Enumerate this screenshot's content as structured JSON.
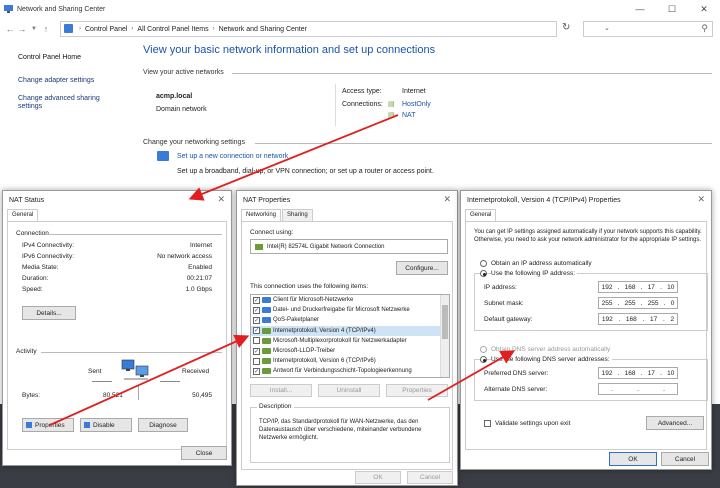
{
  "main": {
    "title": "Network and Sharing Center",
    "breadcrumb": [
      "Control Panel",
      "All Control Panel Items",
      "Network and Sharing Center"
    ],
    "left_pane": [
      "Control Panel Home",
      "Change adapter settings",
      "Change advanced sharing settings"
    ],
    "heading": "View your basic network information and set up connections",
    "active_networks_label": "View your active networks",
    "network_name": "acmp.local",
    "network_type": "Domain network",
    "access_type_label": "Access type:",
    "access_type_value": "Internet",
    "connections_label": "Connections:",
    "connection_1": "HostOnly",
    "connection_2": "NAT",
    "change_settings_label": "Change your networking settings",
    "setup_link": "Set up a new connection or network",
    "setup_desc": "Set up a broadband, dial-up, or VPN connection; or set up a router or access point."
  },
  "status_dlg": {
    "title": "NAT Status",
    "tab": "General",
    "connection_label": "Connection",
    "rows": [
      {
        "k": "IPv4 Connectivity:",
        "v": "Internet"
      },
      {
        "k": "IPv6 Connectivity:",
        "v": "No network access"
      },
      {
        "k": "Media State:",
        "v": "Enabled"
      },
      {
        "k": "Duration:",
        "v": "00:21:07"
      },
      {
        "k": "Speed:",
        "v": "1.0 Gbps"
      }
    ],
    "details_btn": "Details...",
    "activity_label": "Activity",
    "sent_label": "Sent",
    "received_label": "Received",
    "bytes_label": "Bytes:",
    "bytes_sent": "80,521",
    "bytes_received": "50,495",
    "properties_btn": "Properties",
    "disable_btn": "Disable",
    "diagnose_btn": "Diagnose",
    "close_btn": "Close"
  },
  "props_dlg": {
    "title": "NAT Properties",
    "tab_networking": "Networking",
    "tab_sharing": "Sharing",
    "connect_using_label": "Connect using:",
    "adapter": "Intel(R) 82574L Gigabit Network Connection",
    "configure_btn": "Configure...",
    "items_label": "This connection uses the following items:",
    "items": [
      {
        "label": "Client für Microsoft-Netzwerke",
        "checked": true
      },
      {
        "label": "Datei- und Druckerfreigabe für Microsoft Netzwerke",
        "checked": true
      },
      {
        "label": "QoS-Paketplaner",
        "checked": true
      },
      {
        "label": "Internetprotokoll, Version 4 (TCP/IPv4)",
        "checked": true
      },
      {
        "label": "Microsoft-Multiplexorprotokoll für Netzwerkadapter",
        "checked": false
      },
      {
        "label": "Microsoft-LLDP-Treiber",
        "checked": true
      },
      {
        "label": "Internetprotokoll, Version 6 (TCP/IPv6)",
        "checked": false
      },
      {
        "label": "Antwort für Verbindungsschicht-Topologieerkennung",
        "checked": true
      }
    ],
    "install_btn": "Install...",
    "uninstall_btn": "Uninstall",
    "properties_btn": "Properties",
    "description_label": "Description",
    "description": "TCP/IP, das Standardprotokoll für WAN-Netzwerke, das den Datenaustausch über verschiedene, miteinander verbundene Netzwerke ermöglicht.",
    "ok_btn": "OK",
    "cancel_btn": "Cancel"
  },
  "ipv4_dlg": {
    "title": "Internetprotokoll, Version 4 (TCP/IPv4) Properties",
    "tab": "General",
    "intro": "You can get IP settings assigned automatically if your network supports this capability. Otherwise, you need to ask your network administrator for the appropriate IP settings.",
    "auto_ip": "Obtain an IP address automatically",
    "use_ip": "Use the following IP address:",
    "ip_label": "IP address:",
    "ip": [
      "192",
      "168",
      "17",
      "10"
    ],
    "mask_label": "Subnet mask:",
    "mask": [
      "255",
      "255",
      "255",
      "0"
    ],
    "gw_label": "Default gateway:",
    "gw": [
      "192",
      "168",
      "17",
      "2"
    ],
    "auto_dns": "Obtain DNS server address automatically",
    "use_dns": "Use the following DNS server addresses:",
    "pref_dns_label": "Preferred DNS server:",
    "pref_dns": [
      "192",
      "168",
      "17",
      "10"
    ],
    "alt_dns_label": "Alternate DNS server:",
    "alt_dns": [
      ".",
      ".",
      "."
    ],
    "validate": "Validate settings upon exit",
    "advanced_btn": "Advanced...",
    "ok_btn": "OK",
    "cancel_btn": "Cancel"
  }
}
